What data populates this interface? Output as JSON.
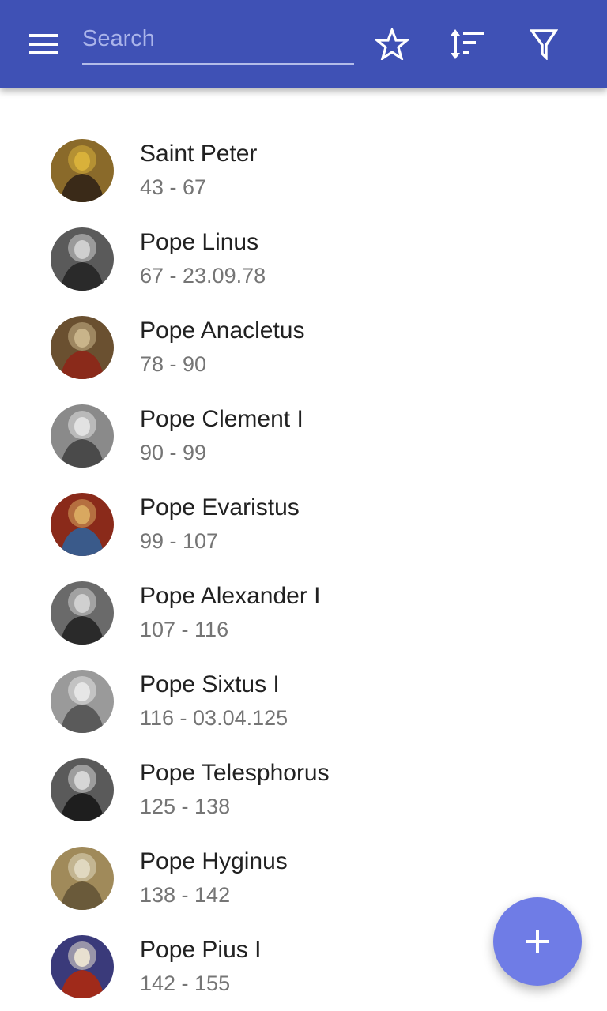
{
  "appbar": {
    "background": "#3f51b5",
    "menu_icon": "hamburger-menu-icon",
    "search": {
      "placeholder": "Search",
      "value": ""
    },
    "actions": [
      {
        "name": "favorites",
        "icon": "star-outline-icon"
      },
      {
        "name": "sort",
        "icon": "sort-icon"
      },
      {
        "name": "filter",
        "icon": "filter-icon"
      }
    ]
  },
  "popes": [
    {
      "name": "Saint Peter",
      "dates": "43 - 67",
      "avatar_colors": [
        "#8a6a2a",
        "#d9b13a",
        "#3a2a18"
      ]
    },
    {
      "name": "Pope Linus",
      "dates": "67 - 23.09.78",
      "avatar_colors": [
        "#5a5a5a",
        "#cfcfcf",
        "#2a2a2a"
      ]
    },
    {
      "name": "Pope Anacletus",
      "dates": "78 - 90",
      "avatar_colors": [
        "#6a5030",
        "#c9b48a",
        "#8a2a1a"
      ]
    },
    {
      "name": "Pope Clement I",
      "dates": "90 - 99",
      "avatar_colors": [
        "#8a8a8a",
        "#e2e2e2",
        "#4a4a4a"
      ]
    },
    {
      "name": "Pope Evaristus",
      "dates": "99 - 107",
      "avatar_colors": [
        "#8a2a1a",
        "#d9a860",
        "#3a5a8a"
      ]
    },
    {
      "name": "Pope Alexander I",
      "dates": "107 - 116",
      "avatar_colors": [
        "#6a6a6a",
        "#d0d0d0",
        "#2a2a2a"
      ]
    },
    {
      "name": "Pope Sixtus I",
      "dates": "116 - 03.04.125",
      "avatar_colors": [
        "#9a9a9a",
        "#e6e6e6",
        "#5a5a5a"
      ]
    },
    {
      "name": "Pope Telesphorus",
      "dates": "125 - 138",
      "avatar_colors": [
        "#5a5a5a",
        "#d6d6d6",
        "#1e1e1e"
      ]
    },
    {
      "name": "Pope Hyginus",
      "dates": "138 - 142",
      "avatar_colors": [
        "#a08a5a",
        "#e0d8c0",
        "#6a5a3a"
      ]
    },
    {
      "name": "Pope Pius I",
      "dates": "142 - 155",
      "avatar_colors": [
        "#3a3a7a",
        "#e8e0d0",
        "#a02a1a"
      ]
    }
  ],
  "fab": {
    "icon": "plus-icon",
    "color": "#6f7ce6"
  }
}
